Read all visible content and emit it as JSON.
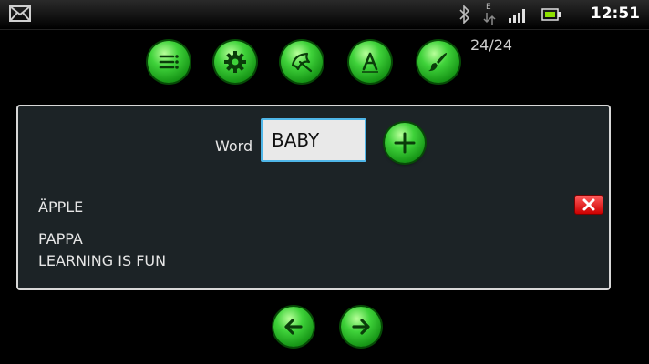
{
  "status_bar": {
    "time": "12:51",
    "icons": [
      "mail-icon",
      "bluetooth-icon",
      "data-icon",
      "signal-icon",
      "battery-icon"
    ],
    "network_letter": "E"
  },
  "toolbar": {
    "buttons": [
      "list-icon",
      "gear-icon",
      "umbrella-icon",
      "font-a-icon",
      "brush-icon"
    ],
    "counter": "24/24"
  },
  "editor": {
    "word_label": "Word",
    "word_value": "BABY",
    "add_icon": "plus-icon"
  },
  "word_list": {
    "items": [
      "ÄPPLE",
      "PAPPA",
      "LEARNING IS FUN"
    ],
    "delete_icon": "close-x-icon"
  },
  "navigation": {
    "prev_icon": "arrow-left-icon",
    "next_icon": "arrow-right-icon"
  },
  "colors": {
    "button_green": "#2fbf2f",
    "input_focus": "#4fb6e8",
    "delete_red": "#e01010",
    "panel_bg": "#1c2326"
  }
}
